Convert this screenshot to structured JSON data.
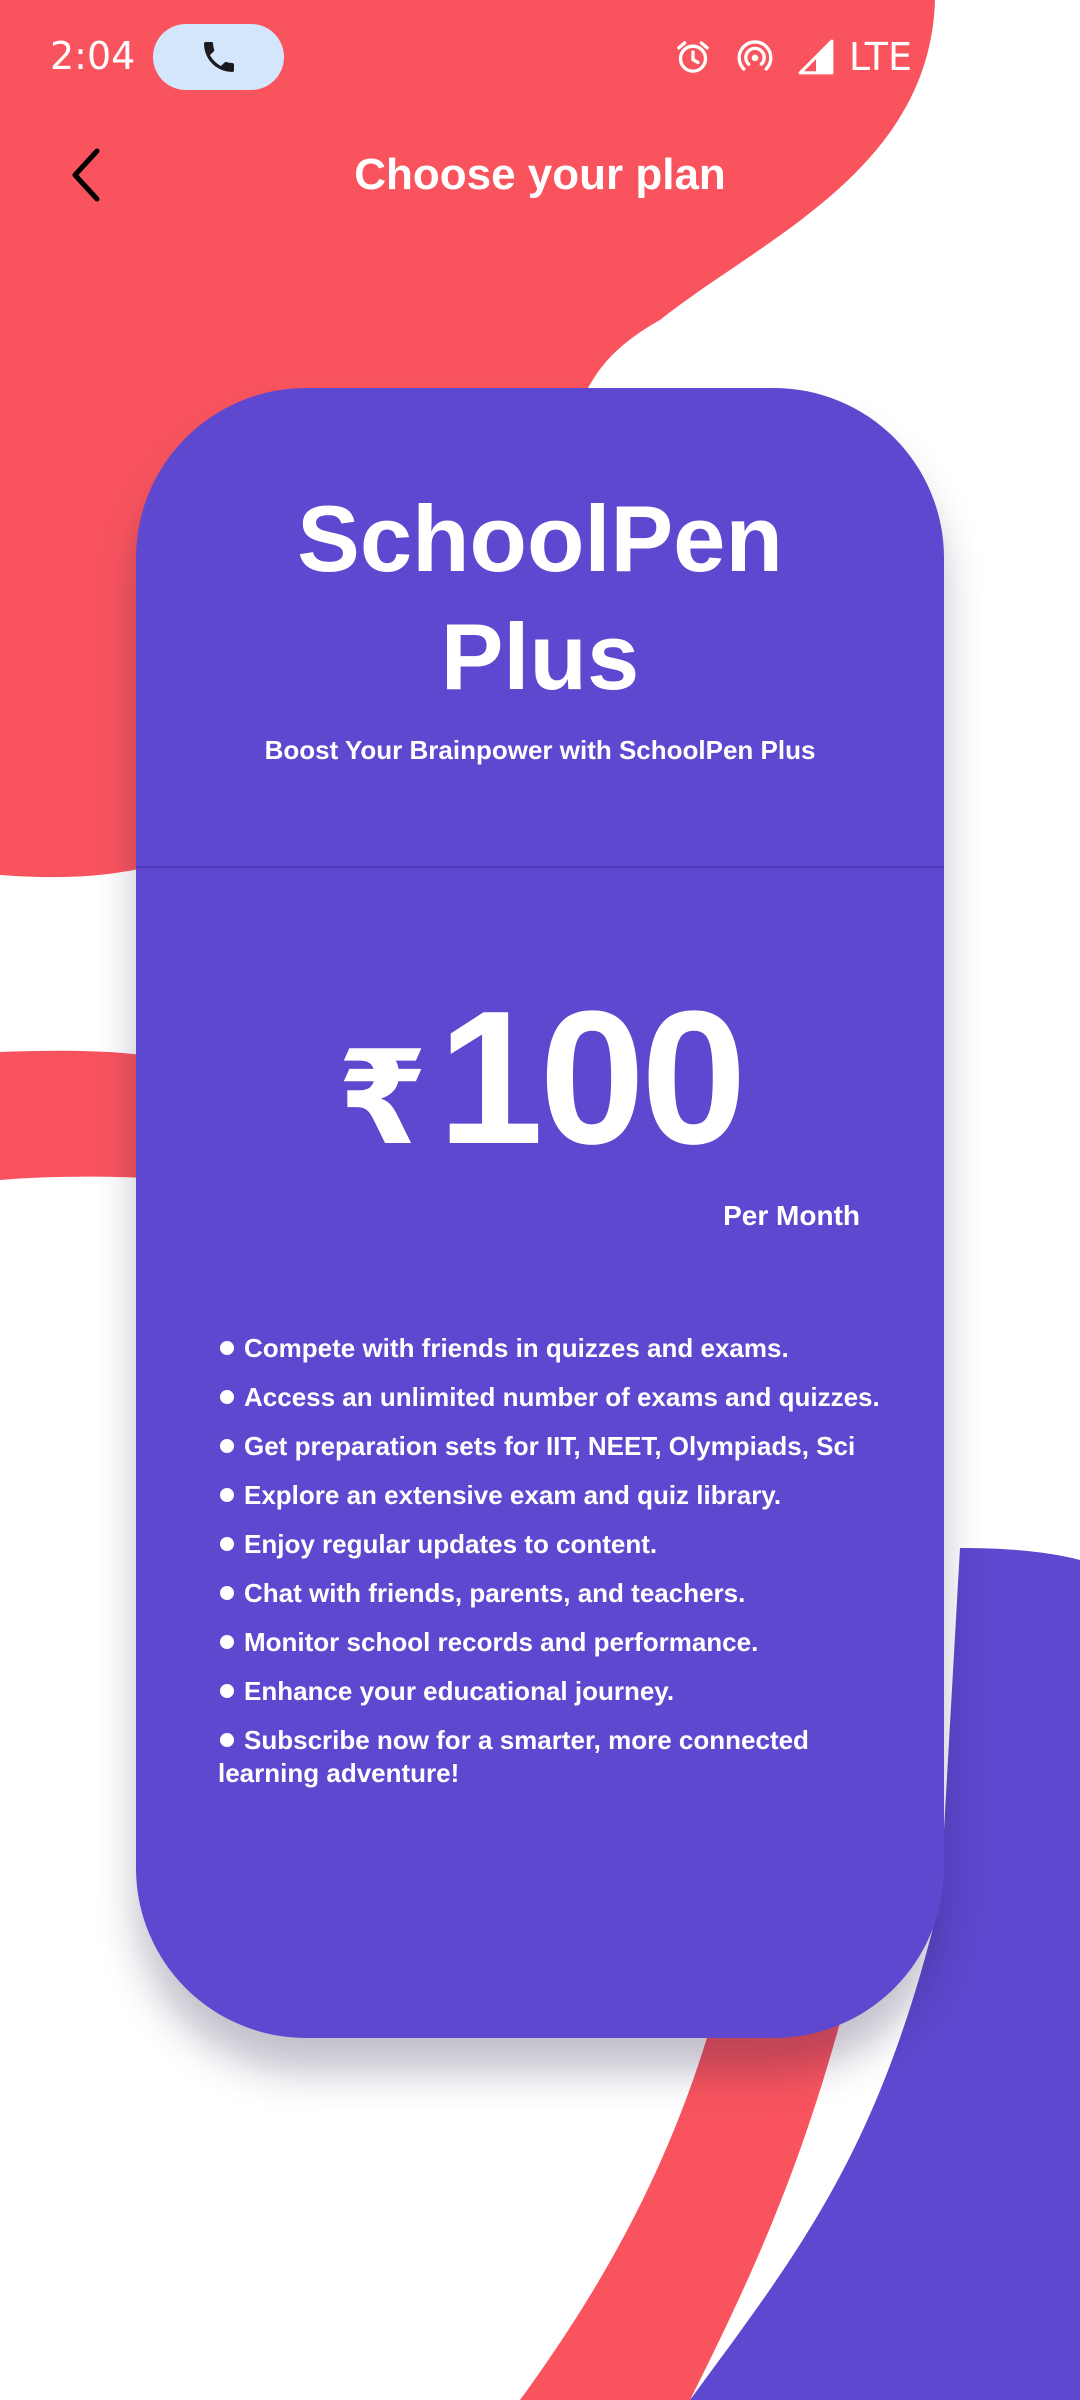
{
  "status_bar": {
    "time": "2:04",
    "call_icon": "phone-icon",
    "icons": [
      "alarm-icon",
      "hotspot-icon",
      "signal-icon"
    ],
    "network": "LTE"
  },
  "header": {
    "back_icon": "back-arrow-icon",
    "title": "Choose your plan"
  },
  "plan": {
    "name_line1": "SchoolPen",
    "name_line2": "Plus",
    "tagline": "Boost Your Brainpower with SchoolPen Plus",
    "currency": "₹",
    "price": "100",
    "period": "Per Month",
    "features": [
      "Compete with friends in quizzes and exams.",
      "Access an unlimited number of exams and quizzes.",
      "Get preparation sets for IIT, NEET, Olympiads, Sci",
      "Explore an extensive exam and quiz library.",
      "Enjoy regular updates to content.",
      "Chat with friends, parents, and teachers.",
      "Monitor school records and performance.",
      "Enhance your educational journey.",
      "Subscribe now for a smarter, more connected learning adventure!"
    ]
  },
  "colors": {
    "coral": "#f9545e",
    "purple": "#5d48cf",
    "white": "#ffffff"
  }
}
